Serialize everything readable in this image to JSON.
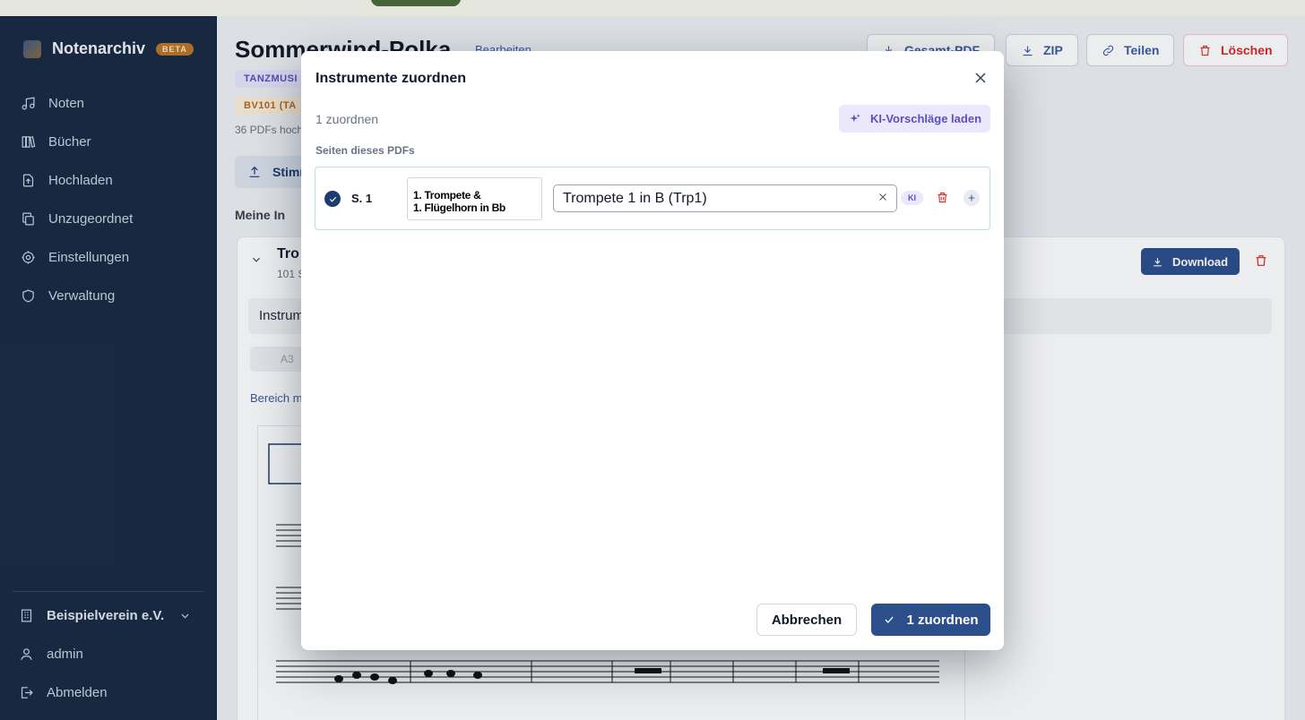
{
  "sidebar": {
    "app_name": "Notenarchiv",
    "badge": "BETA",
    "items": [
      {
        "label": "Noten",
        "icon": "music-note-icon"
      },
      {
        "label": "Bücher",
        "icon": "books-icon"
      },
      {
        "label": "Hochladen",
        "icon": "upload-file-icon"
      },
      {
        "label": "Unzugeordnet",
        "icon": "copy-icon"
      },
      {
        "label": "Einstellungen",
        "icon": "gear-icon"
      },
      {
        "label": "Verwaltung",
        "icon": "shield-icon"
      }
    ],
    "org": "Beispielverein e.V.",
    "user": "admin",
    "logout": "Abmelden"
  },
  "header": {
    "title": "Sommerwind-Polka",
    "edit_link": "Bearbeiten",
    "buttons": {
      "pdf": "Gesamt-PDF",
      "zip": "ZIP",
      "share": "Teilen",
      "delete": "Löschen"
    },
    "tags": {
      "genre": "TANZMUSI",
      "code": "BV101 (TA"
    },
    "meta": "36 PDFs hoch",
    "upload_btn": "Stimm",
    "section_heading": "Meine In"
  },
  "card": {
    "title": "Tro",
    "subtitle": "101 S",
    "download": "Download",
    "instrument_label": "Instrum",
    "chip": "A3",
    "range_link": "Bereich m"
  },
  "modal": {
    "title": "Instrumente zuordnen",
    "count_text": "1 zuordnen",
    "ai_button": "KI-Vorschläge laden",
    "pages_heading": "Seiten dieses PDFs",
    "rows": [
      {
        "page": "S. 1",
        "thumb_line1": "1. Trompete &",
        "thumb_line2": "1. Flügelhorn in Bb",
        "instrument": "Trompete 1 in B (Trp1)",
        "badge": "KI"
      }
    ],
    "cancel": "Abbrechen",
    "confirm": "1 zuordnen"
  },
  "colors": {
    "sidebar_bg": "#1b2a44",
    "primary": "#2c4f8c",
    "ai_accent": "#5b4fc4",
    "danger": "#dc2626",
    "row_border": "#bfe3c7"
  }
}
